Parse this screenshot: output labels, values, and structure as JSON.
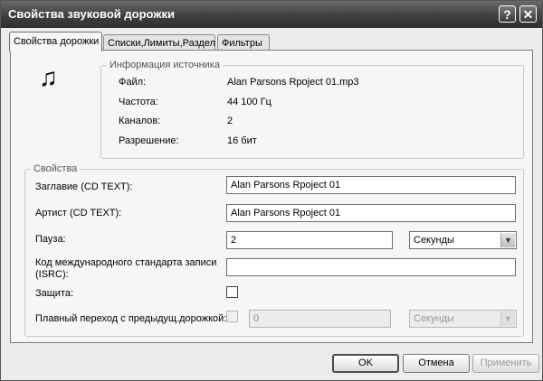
{
  "window": {
    "title": "Свойства звуковой дорожки"
  },
  "titlebar_buttons": {
    "help": "?",
    "close": "✕"
  },
  "tabs": [
    {
      "label": "Свойства дорожки"
    },
    {
      "label": "Списки,Лимиты,Раздел"
    },
    {
      "label": "Фильтры"
    }
  ],
  "source_info": {
    "legend": "Информация источника",
    "rows": [
      {
        "label": "Файл:",
        "value": "Alan Parsons Rpoject 01.mp3"
      },
      {
        "label": "Частота:",
        "value": "44 100 Гц"
      },
      {
        "label": "Каналов:",
        "value": "2"
      },
      {
        "label": "Разрешение:",
        "value": "16 бит"
      }
    ]
  },
  "properties": {
    "legend": "Свойства",
    "title_label": "Заглавие (CD TEXT):",
    "title_value": "Alan Parsons Rpoject 01",
    "artist_label": "Артист (CD TEXT):",
    "artist_value": "Alan Parsons Rpoject 01",
    "pause_label": "Пауза:",
    "pause_value": "2",
    "pause_unit": "Секунды",
    "isrc_label_line1": "Код международного стандарта записи",
    "isrc_label_line2": "(ISRC):",
    "isrc_value": "",
    "protection_label": "Защита:",
    "protection_checked": false,
    "crossfade_label": "Плавный переход с предыдущ.дорожкой:",
    "crossfade_checked": false,
    "crossfade_value": "0",
    "crossfade_unit": "Секунды"
  },
  "buttons": {
    "ok": "OK",
    "cancel": "Отмена",
    "apply": "Применить"
  },
  "icons": {
    "music": "music-notes-icon",
    "dropdown": "chevron-down-icon"
  }
}
